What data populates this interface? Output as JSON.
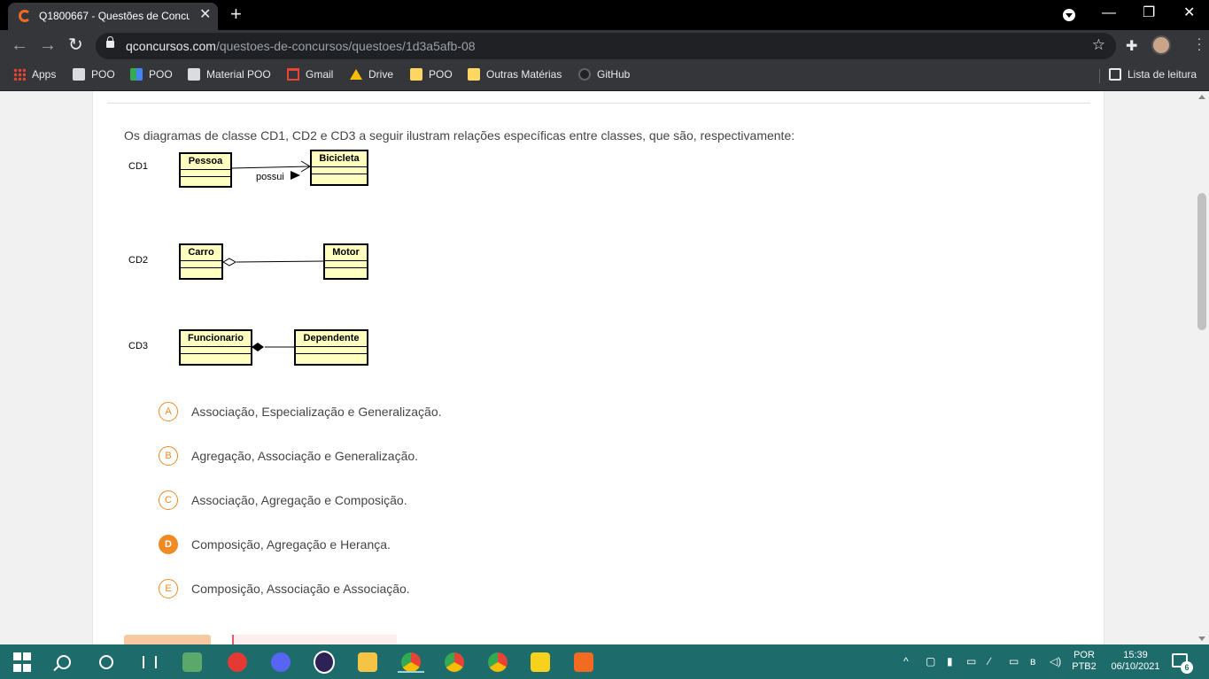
{
  "browser": {
    "tab_title": "Q1800667 - Questões de Concur",
    "tab_close": "✕",
    "new_tab": "+",
    "url_host": "qconcursos.com",
    "url_path": "/questoes-de-concursos/questoes/1d3a5afb-08",
    "bookmarks": [
      "Apps",
      "POO",
      "POO",
      "Material POO",
      "Gmail",
      "Drive",
      "POO",
      "Outras Matérias",
      "GitHub"
    ],
    "reading_list": "Lista de leitura"
  },
  "question": {
    "text": "Os diagramas de classe CD1, CD2 e CD3 a seguir ilustram relações específicas entre classes, que são, respectivamente:",
    "diagrams": [
      {
        "label": "CD1",
        "left": "Pessoa",
        "right": "Bicicleta",
        "relation": "association",
        "role": "possui"
      },
      {
        "label": "CD2",
        "left": "Carro",
        "right": "Motor",
        "relation": "aggregation"
      },
      {
        "label": "CD3",
        "left": "Funcionario",
        "right": "Dependente",
        "relation": "composition"
      }
    ],
    "options": [
      {
        "letter": "A",
        "text": "Associação, Especialização e Generalização."
      },
      {
        "letter": "B",
        "text": "Agregação, Associação e Generalização."
      },
      {
        "letter": "C",
        "text": "Associação, Agregação e Composição."
      },
      {
        "letter": "D",
        "text": "Composição, Agregação e Herança."
      },
      {
        "letter": "E",
        "text": "Composição, Associação e Associação."
      }
    ],
    "selected": "D"
  },
  "taskbar": {
    "lang_top": "POR",
    "lang_bottom": "PTB2",
    "time": "15:39",
    "date": "06/10/2021",
    "notifications": "6"
  },
  "colors": {
    "accent": "#f08a24",
    "taskbar": "#1e6b6b",
    "uml_fill": "#ffffc0"
  }
}
